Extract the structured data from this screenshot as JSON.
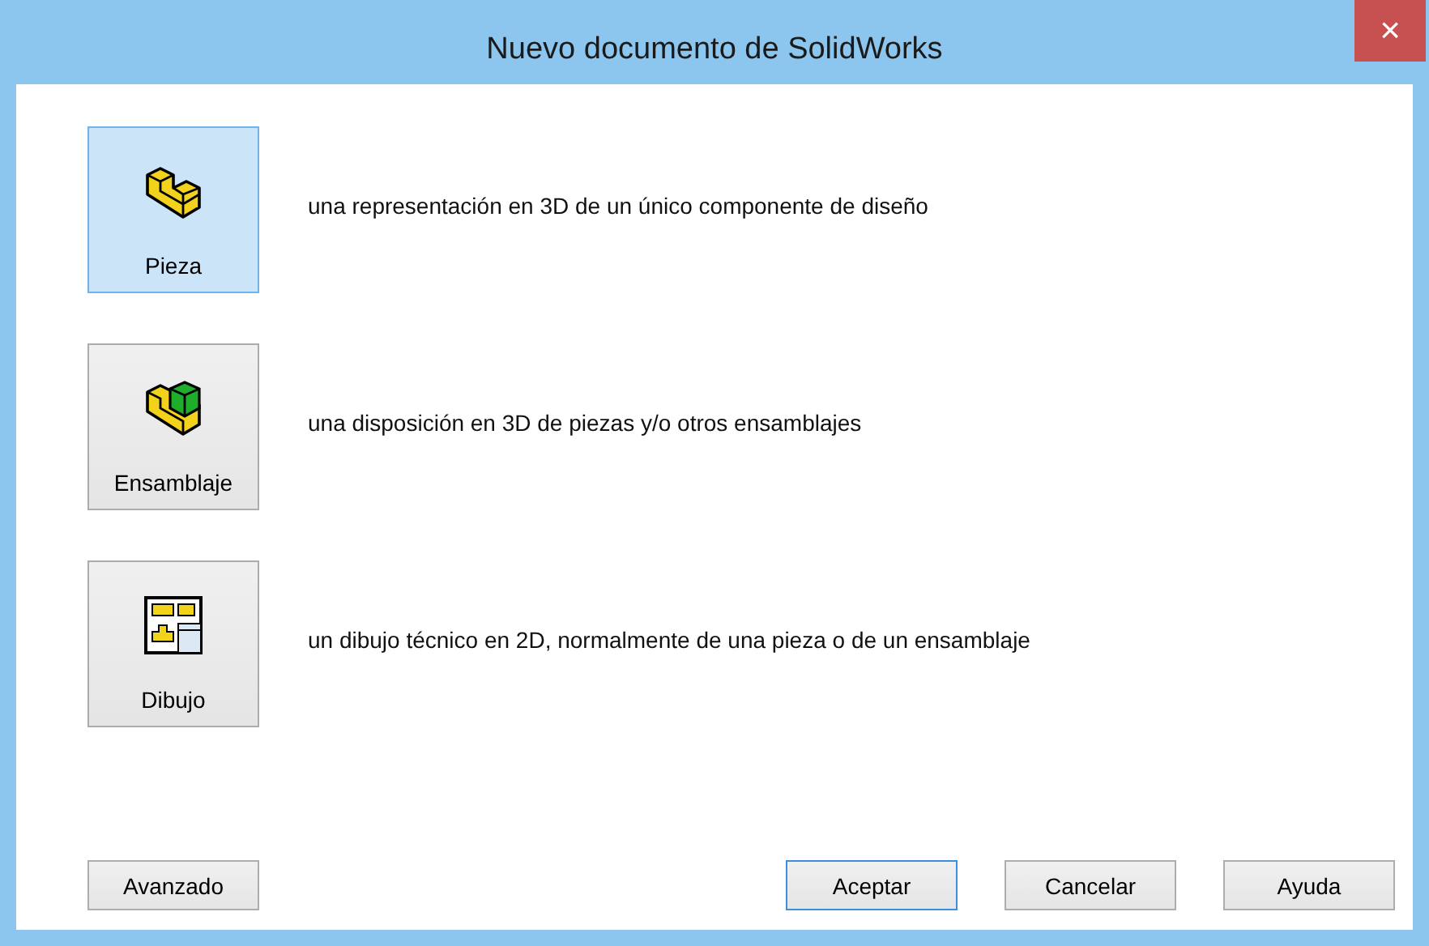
{
  "window": {
    "title": "Nuevo documento de SolidWorks",
    "close": "×"
  },
  "document_types": [
    {
      "kind": "part",
      "label": "Pieza",
      "description": "una representación en 3D de un único componente de diseño",
      "selected": true
    },
    {
      "kind": "assembly",
      "label": "Ensamblaje",
      "description": "una disposición en 3D de piezas y/o otros ensamblajes",
      "selected": false
    },
    {
      "kind": "drawing",
      "label": "Dibujo",
      "description": "un dibujo técnico en 2D, normalmente de una pieza o de un ensamblaje",
      "selected": false
    }
  ],
  "left_button": {
    "label": "Avanzado",
    "default": false
  },
  "buttons": [
    {
      "label": "Aceptar",
      "default": true
    },
    {
      "label": "Cancelar",
      "default": false
    },
    {
      "label": "Ayuda",
      "default": false
    }
  ]
}
